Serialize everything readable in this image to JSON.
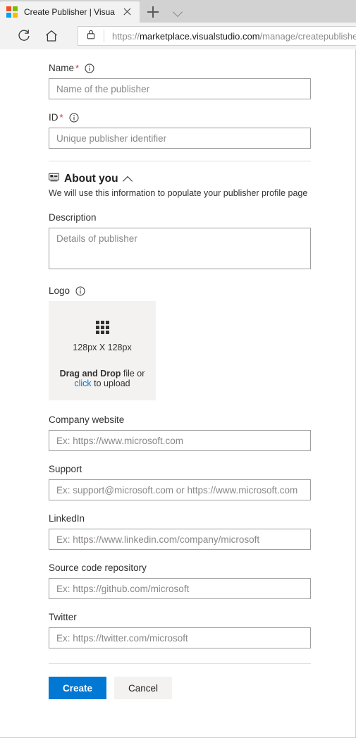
{
  "browser": {
    "tab": {
      "title": "Create Publisher | Visua",
      "favicon": "microsoft-logo-icon"
    },
    "new_tab_label": "+",
    "tab_menu_icon": "chevron-down-icon",
    "close_icon": "close-icon",
    "reload_icon": "reload-icon",
    "home_icon": "home-icon",
    "lock_icon": "lock-icon",
    "url": {
      "scheme": "https://",
      "host": "marketplace.visualstudio.com",
      "path": "/manage/createpublisher"
    }
  },
  "form": {
    "name": {
      "label": "Name",
      "required_mark": "*",
      "info_icon": "info-icon",
      "placeholder": "Name of the publisher",
      "value": ""
    },
    "id": {
      "label": "ID",
      "required_mark": "*",
      "info_icon": "info-icon",
      "placeholder": "Unique publisher identifier",
      "value": ""
    },
    "about": {
      "section_icon": "id-card-icon",
      "title": "About you",
      "collapse_icon": "chevron-up-icon",
      "subtitle": "We will use this information to populate your publisher profile page"
    },
    "description": {
      "label": "Description",
      "placeholder": "Details of publisher",
      "value": ""
    },
    "logo": {
      "label": "Logo",
      "info_icon": "info-icon",
      "grid_icon": "grid-icon",
      "size_text": "128px X 128px",
      "drag_bold": "Drag and Drop",
      "drag_rest": " file or",
      "click_link": "click",
      "click_rest": " to upload"
    },
    "company_website": {
      "label": "Company website",
      "placeholder": "Ex: https://www.microsoft.com",
      "value": ""
    },
    "support": {
      "label": "Support",
      "placeholder": "Ex: support@microsoft.com or https://www.microsoft.com",
      "value": ""
    },
    "linkedin": {
      "label": "LinkedIn",
      "placeholder": "Ex: https://www.linkedin.com/company/microsoft",
      "value": ""
    },
    "source_repo": {
      "label": "Source code repository",
      "placeholder": "Ex: https://github.com/microsoft",
      "value": ""
    },
    "twitter": {
      "label": "Twitter",
      "placeholder": "Ex: https://twitter.com/microsoft",
      "value": ""
    },
    "actions": {
      "create_label": "Create",
      "cancel_label": "Cancel"
    }
  },
  "colors": {
    "accent": "#0078d4",
    "required": "#d13438",
    "dropzone_bg": "#f3f2f1",
    "input_border": "#a19f9d",
    "divider": "#e1dfdd"
  }
}
